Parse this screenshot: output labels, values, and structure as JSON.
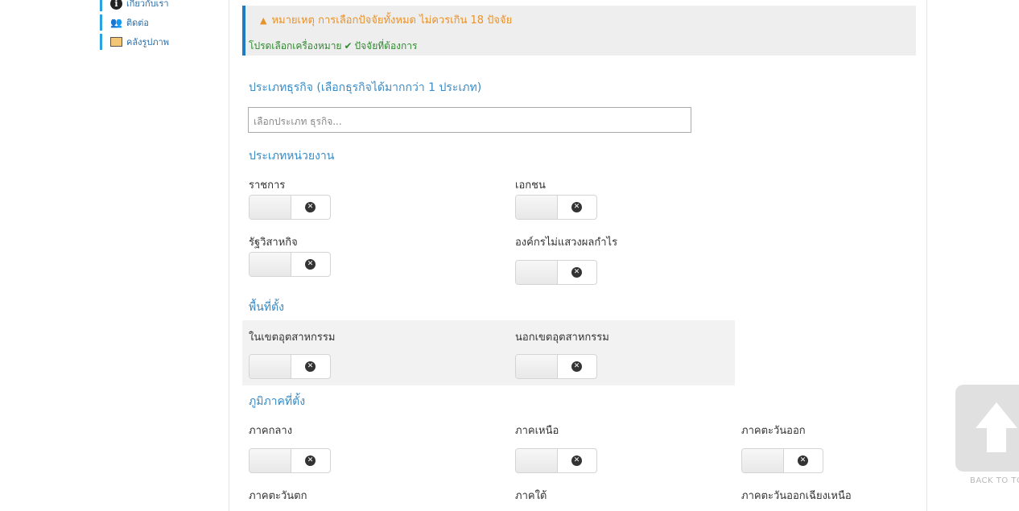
{
  "sidebar": {
    "items": [
      {
        "label": "เกี่ยวกับเรา",
        "icon": "info-icon"
      },
      {
        "label": "ติดต่อ",
        "icon": "users-icon"
      },
      {
        "label": "คลังรูปภาพ",
        "icon": "gallery-icon"
      }
    ]
  },
  "note": {
    "warning": "หมายเหตุ การเลือกปัจจัยทั้งหมด ไม่ควรเกิน 18 ปัจจัย",
    "hint_before": "โปรดเลือกเครื่องหมาย",
    "hint_after": "ปัจจัยที่ต้องการ"
  },
  "business": {
    "title": "ประเภทธุรกิจ (เลือกธุรกิจได้มากกว่า 1 ประเภท)",
    "placeholder": "เลือกประเภท ธุรกิจ..."
  },
  "agency": {
    "title": "ประเภทหน่วยงาน",
    "options": [
      "ราชการ",
      "เอกชน",
      "รัฐวิสาหกิจ",
      "องค์กรไม่แสวงผลกำไร"
    ]
  },
  "location": {
    "title": "พื้นที่ตั้ง",
    "options": [
      "ในเขตอุตสาหกรรม",
      "นอกเขตอุตสาหกรรม"
    ]
  },
  "region": {
    "title": "ภูมิภาคที่ตั้ง",
    "options": [
      "ภาคกลาง",
      "ภาคเหนือ",
      "ภาคตะวันออก",
      "ภาคตะวันตก",
      "ภาคใต้",
      "ภาคตะวันออกเฉียงเหนือ"
    ]
  },
  "back_to_top": {
    "label": "BACK TO TO"
  },
  "colors": {
    "accent": "#3a8bc5",
    "warning": "#e8922a",
    "success": "#2e8b2e",
    "note_border": "#1e7bc4"
  }
}
